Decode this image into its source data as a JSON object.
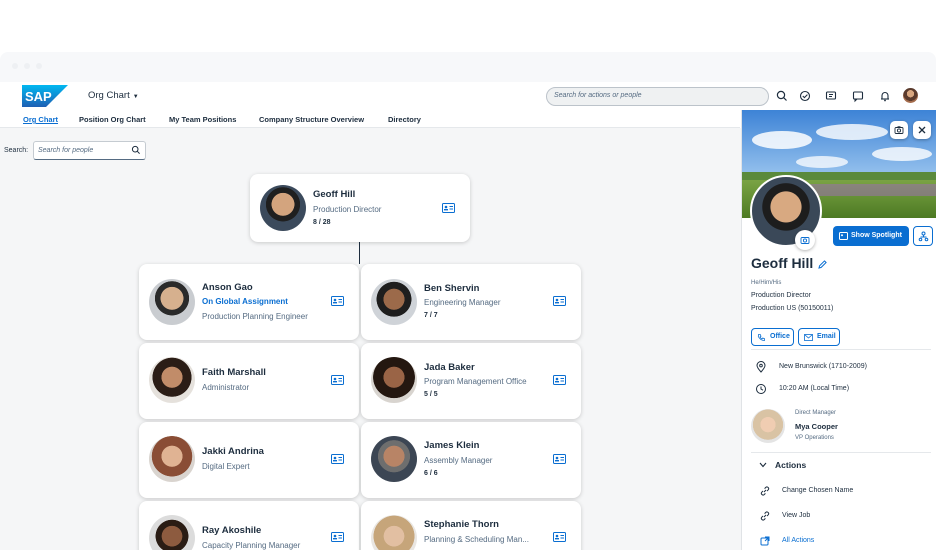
{
  "shell": {
    "app_title": "Org Chart",
    "search_placeholder": "Search for actions or people"
  },
  "tabs": [
    "Org Chart",
    "Position Org Chart",
    "My Team Positions",
    "Company Structure Overview",
    "Directory"
  ],
  "search": {
    "label": "Search:",
    "placeholder": "Search for people"
  },
  "root": {
    "name": "Geoff Hill",
    "title": "Production Director",
    "count": "8 / 28"
  },
  "reports": [
    {
      "name": "Anson Gao",
      "status": "On Global Assignment",
      "title": "Production Planning Engineer",
      "count": ""
    },
    {
      "name": "Ben Shervin",
      "status": "",
      "title": "Engineering Manager",
      "count": "7 / 7"
    },
    {
      "name": "Faith Marshall",
      "status": "",
      "title": "Administrator",
      "count": ""
    },
    {
      "name": "Jada Baker",
      "status": "",
      "title": "Program Management Office",
      "count": "5 / 5"
    },
    {
      "name": "Jakki Andrina",
      "status": "",
      "title": "Digital Expert",
      "count": ""
    },
    {
      "name": "James Klein",
      "status": "",
      "title": "Assembly Manager",
      "count": "6 / 6"
    },
    {
      "name": "Ray Akoshile",
      "status": "",
      "title": "Capacity Planning Manager",
      "count": ""
    },
    {
      "name": "Stephanie Thorn",
      "status": "",
      "title": "Planning & Scheduling Man...",
      "count": ""
    }
  ],
  "profile": {
    "spotlight_label": "Show Spotlight",
    "name": "Geoff Hill",
    "pronouns": "He/Him/His",
    "title": "Production Director",
    "department": "Production US (50150011)",
    "office_label": "Office",
    "email_label": "Email",
    "location": "New Brunswick (1710-2009)",
    "local_time": "10:20 AM (Local Time)",
    "manager_heading": "Direct Manager",
    "manager_name": "Mya Cooper",
    "manager_title": "VP Operations",
    "actions_heading": "Actions",
    "actions": [
      "Change Chosen Name",
      "View Job",
      "All Actions"
    ]
  },
  "colors": {
    "brand_blue": "#0a6ed1",
    "text_dark": "#1d2d3e",
    "text_muted": "#556b82",
    "canvas_bg": "#f5f6f7"
  }
}
